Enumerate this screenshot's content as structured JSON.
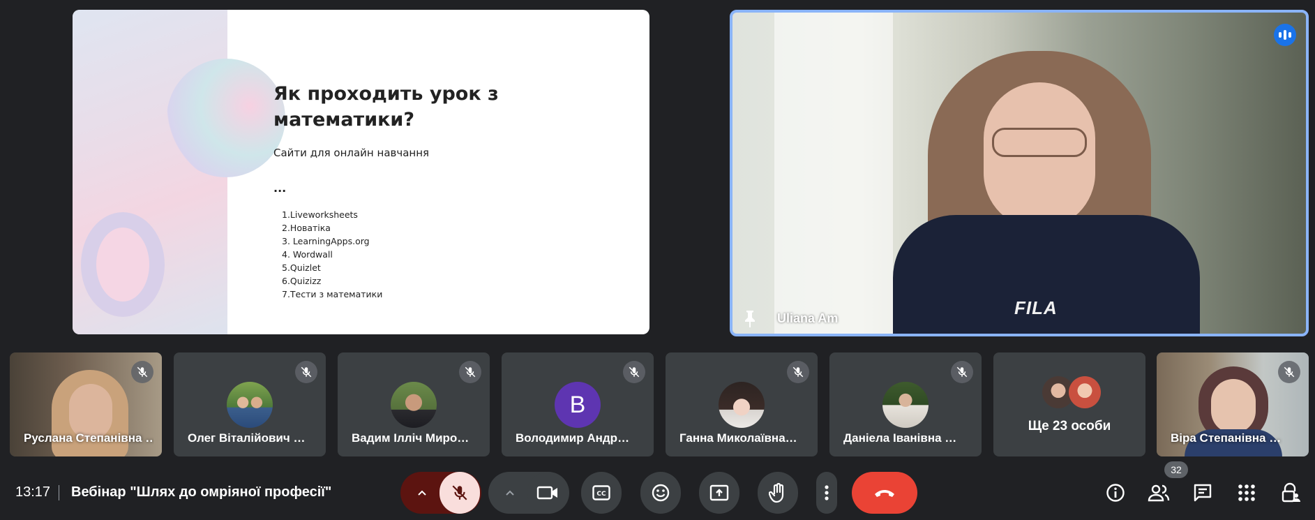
{
  "slide": {
    "title": "Як проходить урок з математики?",
    "subtitle": "Сайти для онлайн навчання",
    "dots": "...",
    "items": [
      "1.Liveworksheets",
      "2.Новатіка",
      "3. LearningApps.org",
      "4.  Wordwall",
      "5.Quizlet",
      "6.Quizizz",
      "7.Тести з математики"
    ]
  },
  "speaker": {
    "name": "Uliana Am",
    "shirt_text": "FILA",
    "pin_icon": "pin-icon",
    "speaking_icon": "audio-level-icon"
  },
  "participants": [
    {
      "name": "Руслана Степанівна …",
      "type": "video"
    },
    {
      "name": "Олег Віталійович …",
      "type": "photo"
    },
    {
      "name": "Вадим Ілліч Миро…",
      "type": "photo"
    },
    {
      "name": "Володимир Андр…",
      "type": "letter",
      "letter": "B"
    },
    {
      "name": "Ганна Миколаївна…",
      "type": "photo"
    },
    {
      "name": "Даніела Іванівна …",
      "type": "photo"
    },
    {
      "name": "Ще 23 особи",
      "type": "more"
    },
    {
      "name": "Віра Степанівна …",
      "type": "video"
    }
  ],
  "bottom": {
    "time": "13:17",
    "meeting_title": "Вебінар \"Шлях до омріяної професії\"",
    "people_count": "32"
  },
  "colors": {
    "background": "#202124",
    "tile": "#3c4043",
    "accent_blue": "#8ab4f8",
    "end_call_red": "#ea4335",
    "mic_off_dark": "#5c1410",
    "mic_off_light": "#f9dedc"
  }
}
